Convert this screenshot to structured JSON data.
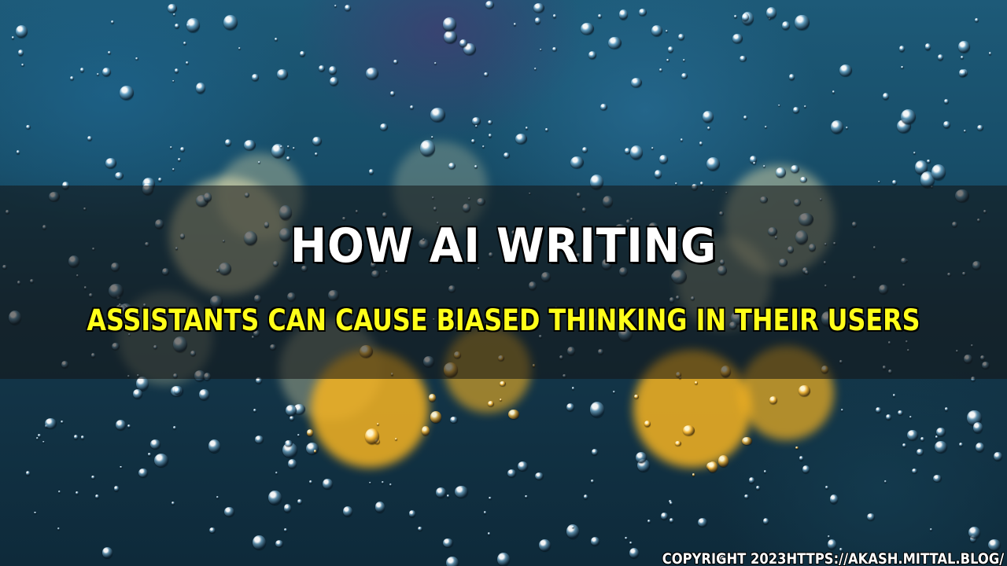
{
  "headline": {
    "line1": "HOW AI WRITING",
    "line2": "ASSISTANTS CAN CAUSE BIASED THINKING IN THEIR USERS"
  },
  "footer": {
    "credit": "COPYRIGHT 2023HTTPS://AKASH.MITTAL.BLOG/"
  },
  "colors": {
    "line1": "#ffffff",
    "line2": "#ffff1a",
    "banner": "rgba(20,20,20,0.55)",
    "bokeh_warm": "#f5b321",
    "bokeh_cream": "#efe6b0",
    "background": "#174d68"
  }
}
